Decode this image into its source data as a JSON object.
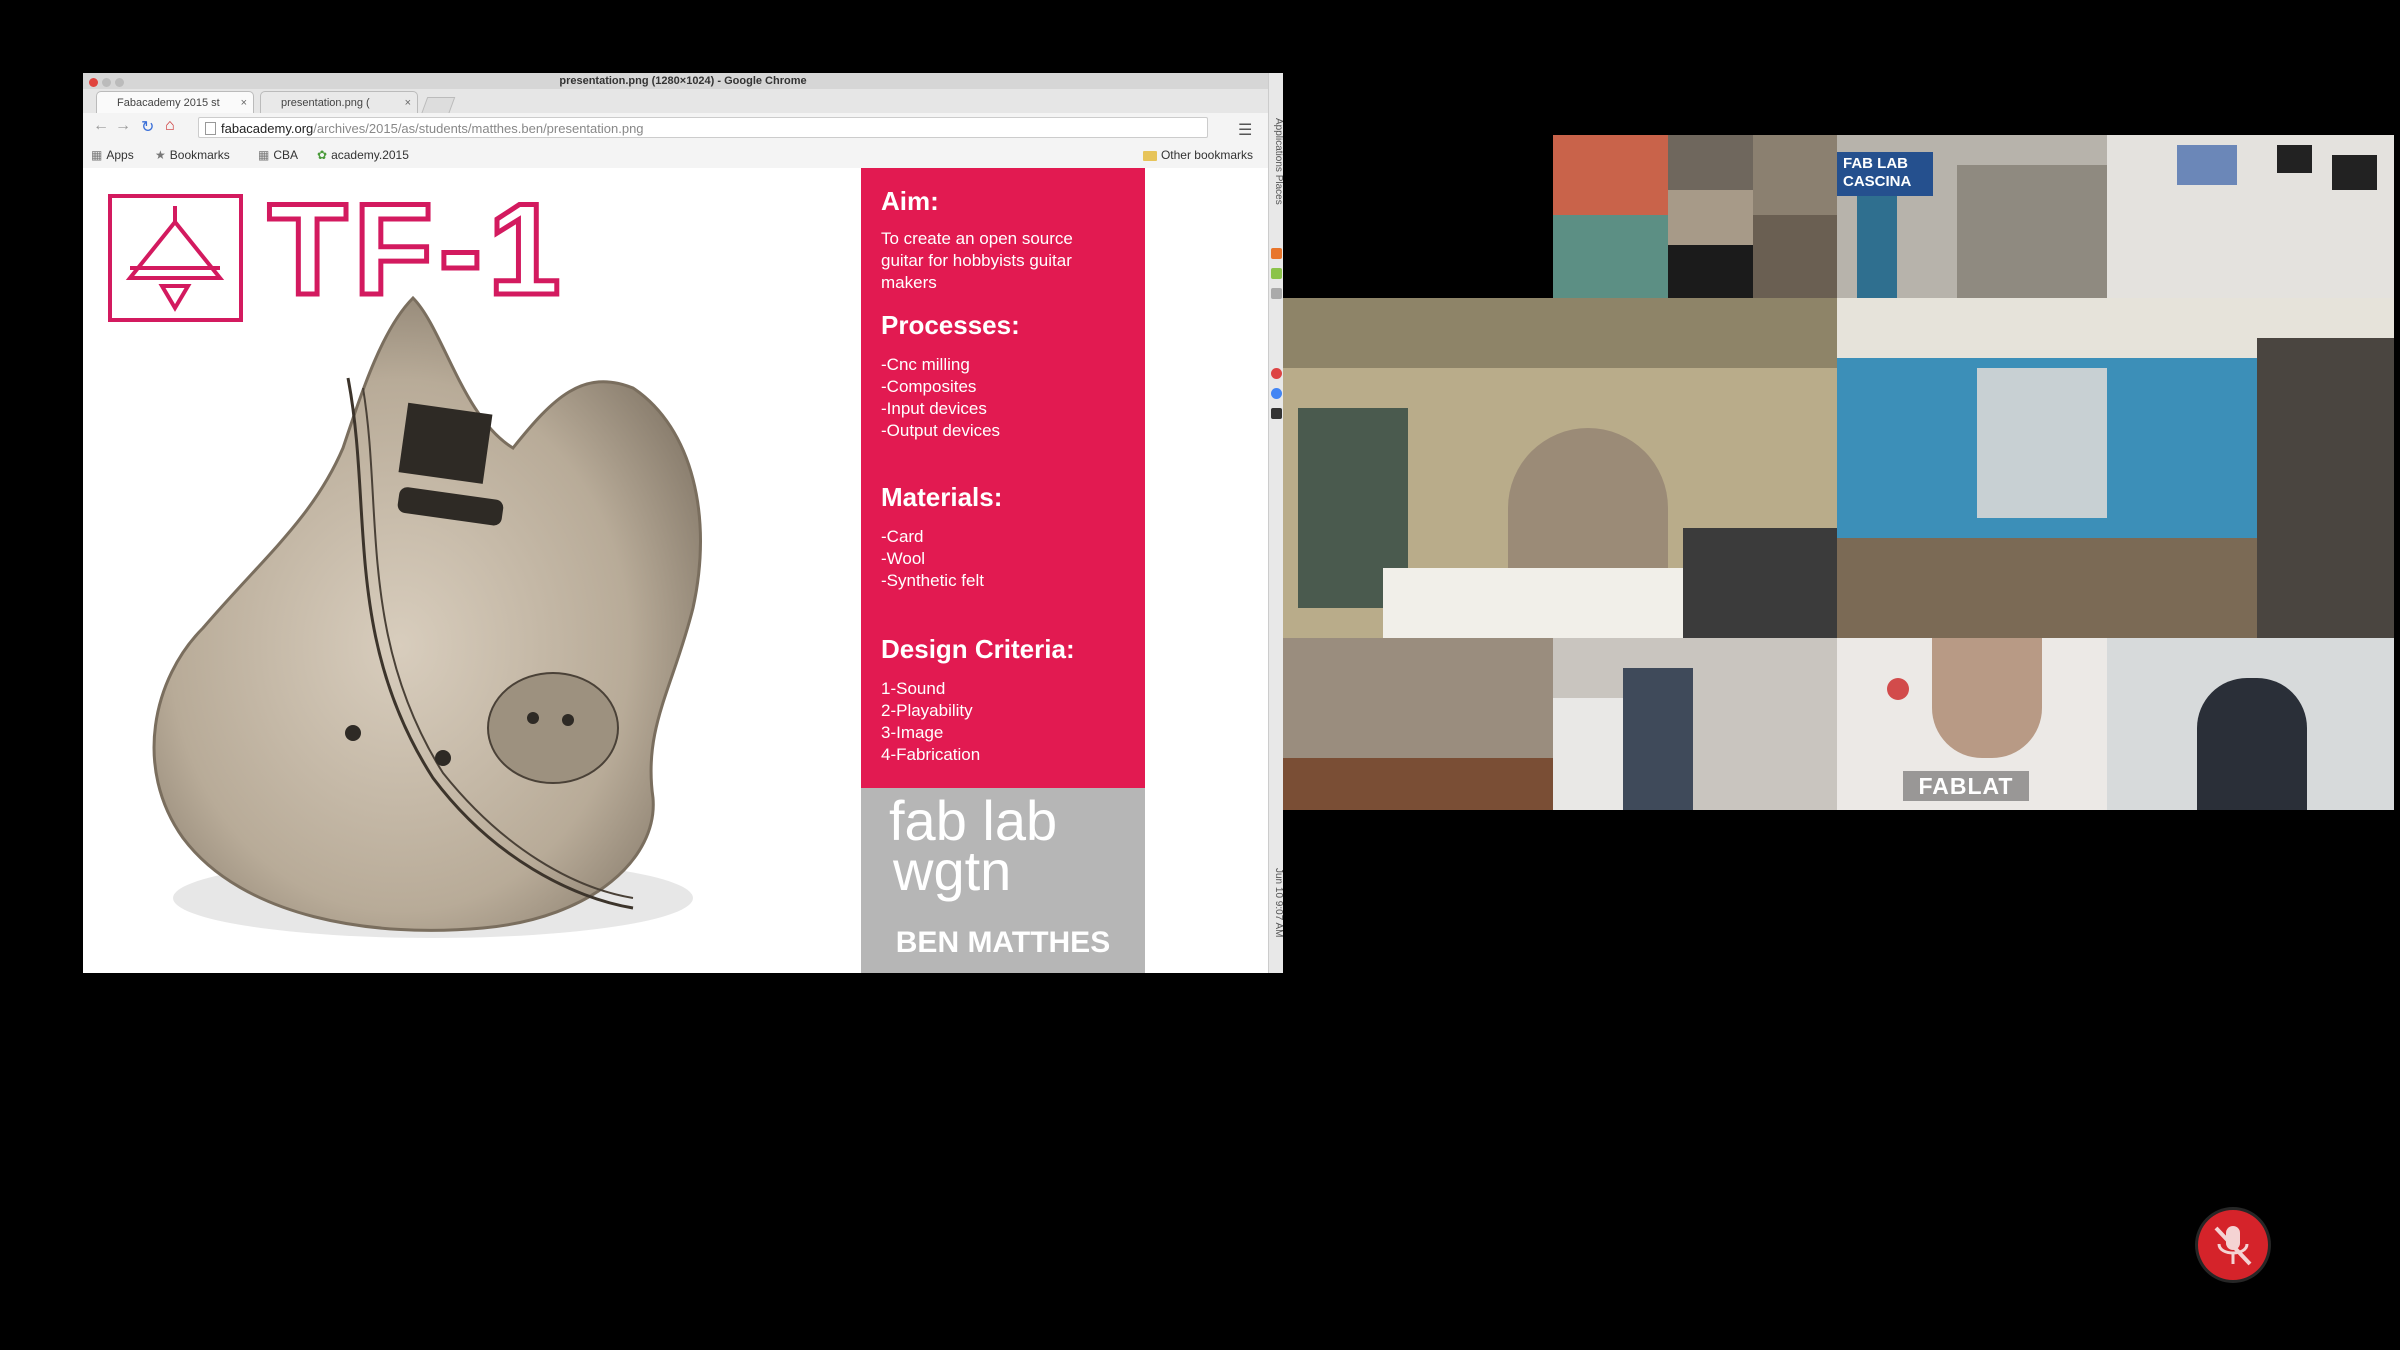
{
  "window": {
    "title": "presentation.png (1280×1024) - Google Chrome"
  },
  "tabs": [
    {
      "label": "Fabacademy 2015 st",
      "close": "×"
    },
    {
      "label": "presentation.png (",
      "close": "×"
    }
  ],
  "address_bar": {
    "host": "fabacademy.org",
    "path": "/archives/2015/as/students/matthes.ben/presentation.png"
  },
  "bookmarks": {
    "items": [
      {
        "label": "Apps",
        "icon": "apps-icon"
      },
      {
        "label": "Bookmarks",
        "icon": "star-icon"
      },
      {
        "label": "CBA",
        "icon": "grid-icon"
      },
      {
        "label": "academy.2015",
        "icon": "flower-icon"
      }
    ],
    "other": "Other bookmarks"
  },
  "side_strip": {
    "top_text": "Applications  Places",
    "bottom_text": "Jun 10  9:07 AM"
  },
  "slide": {
    "logo_text": "TF-1",
    "sections": [
      {
        "heading": "Aim:",
        "body": "To create an open source\nguitar for hobbyists guitar\nmakers"
      },
      {
        "heading": "Processes:",
        "body": "-Cnc milling\n-Composites\n-Input devices\n-Output devices"
      },
      {
        "heading": "Materials:",
        "body": "-Card\n-Wool\n-Synthetic felt"
      },
      {
        "heading": "Design Criteria:",
        "body": "1-Sound\n2-Playability\n3-Image\n4-Fabrication"
      }
    ],
    "fab_logo_line1": "fab  lab",
    "fab_logo_line2": "wgtn",
    "author": "BEN MATTHES",
    "colors": {
      "accent": "#e21a51",
      "logo_pink": "#d31a5f",
      "gray_panel": "#b6b6b6"
    }
  },
  "videos": {
    "fablab_sign": "FAB LAB\nCASCINA",
    "fablat_label": "FABLAT"
  },
  "mute_button": {
    "icon": "mic-muted-icon",
    "color": "#d5232a"
  }
}
